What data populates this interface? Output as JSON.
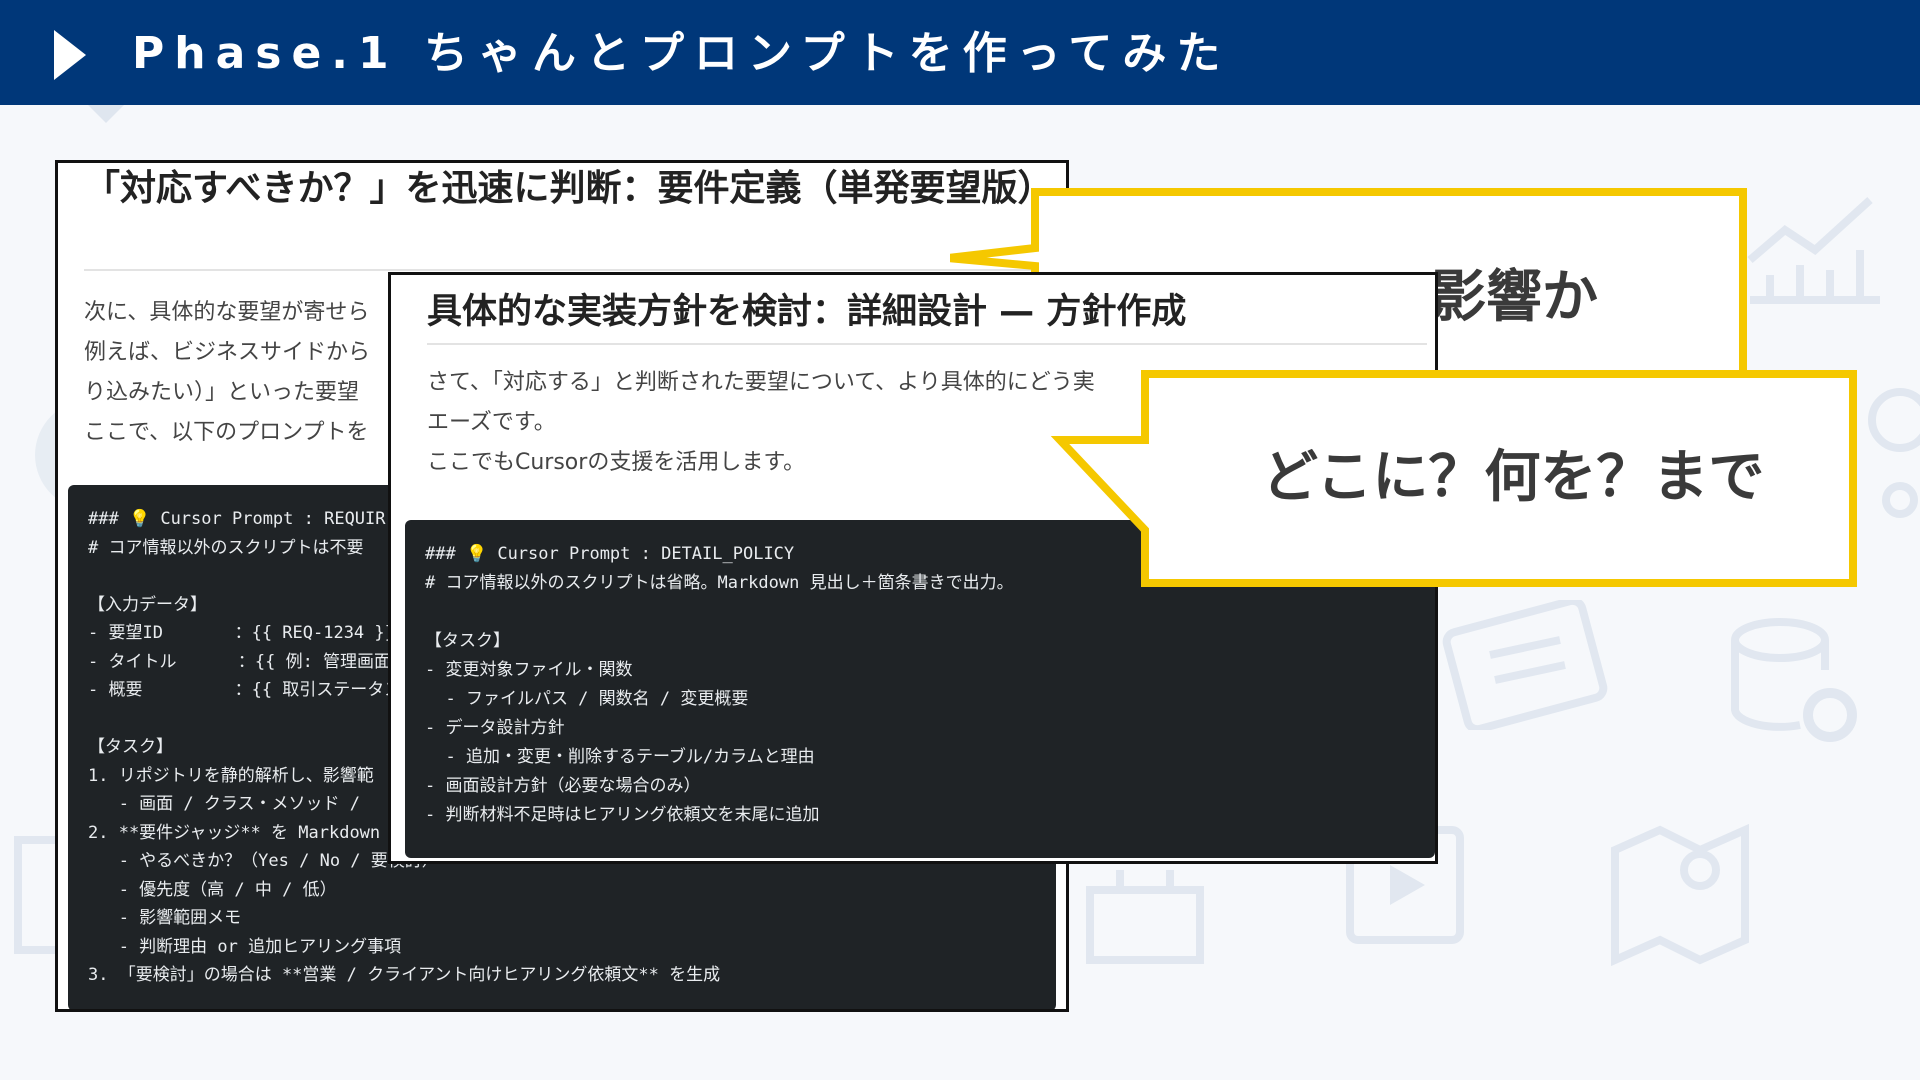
{
  "header": {
    "title": "Phase.1  ちゃんとプロンプトを作ってみた"
  },
  "back_card": {
    "heading": "「対応すべきか？」を迅速に判断：要件定義（単発要望版）",
    "paragraph": "次に、具体的な要望が寄せら\n例えば、ビジネスサイドから\nり込みたい）」といった要望\nここで、以下のプロンプトを",
    "code": "### 💡 Cursor Prompt : REQUIR\n# コア情報以外のスクリプトは不要\n\n【入力データ】\n- 要望ID       ：{{ REQ-1234 }}\n- タイトル      ：{{ 例: 管理画面\n- 概要         ：{{ 取引ステータス\n\n【タスク】\n1. リポジトリを静的解析し、影響範\n   - 画面 / クラス・メソッド / \n2. **要件ジャッジ** を Markdown\n   - やるべきか？（Yes / No / 要検討）\n   - 優先度（高 / 中 / 低）\n   - 影響範囲メモ\n   - 判断理由 or 追加ヒアリング事項\n3. 「要検討」の場合は **営業 / クライアント向けヒアリング依頼文** を生成"
  },
  "front_card": {
    "heading": "具体的な実装方針を検討：詳細設計 — 方針作成",
    "paragraph": "さて、「対応する」と判断された要望について、より具体的にどう実\nエーズです。\nここでもCursorの支援を活用します。",
    "code": "### 💡 Cursor Prompt : DETAIL_POLICY\n# コア情報以外のスクリプトは省略。Markdown 見出し＋箇条書きで出力。\n\n【タスク】\n- 変更対象ファイル・関数\n  - ファイルパス / 関数名 / 変更概要\n- データ設計方針\n  - 追加・変更・削除するテーブル/カラムと理由\n- 画面設計方針（必要な場合のみ）\n- 判断材料不足時はヒアリング依頼文を末尾に追加"
  },
  "callouts": {
    "upper_text": "影響か",
    "lower_text": "どこに？何を？まで",
    "border_color": "#f5c800"
  },
  "colors": {
    "header_bg": "#003779",
    "code_bg": "#1f2326"
  }
}
